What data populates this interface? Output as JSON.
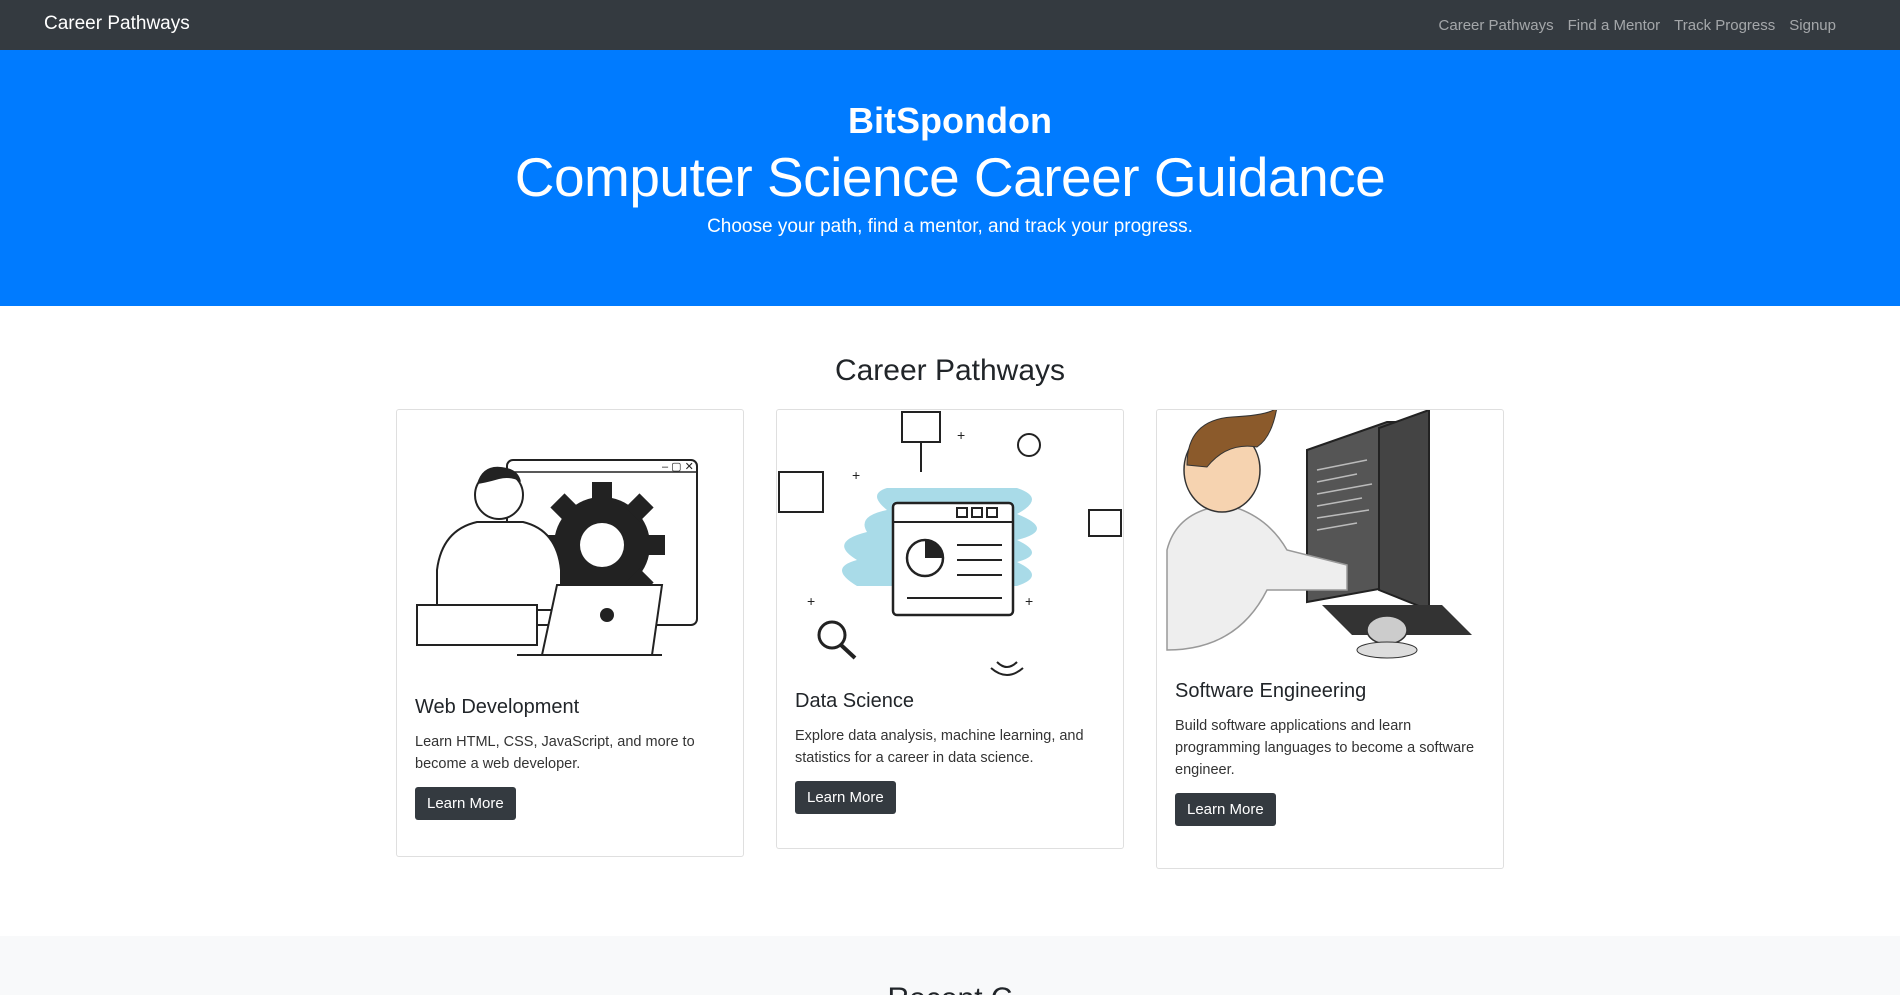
{
  "nav": {
    "brand": "Career Pathways",
    "links": [
      "Career Pathways",
      "Find a Mentor",
      "Track Progress",
      "Signup"
    ]
  },
  "hero": {
    "brand": "BitSpondon",
    "title": "Computer Science Career Guidance",
    "subtitle": "Choose your path, find a mentor, and track your progress."
  },
  "pathways": {
    "title": "Career Pathways",
    "cards": [
      {
        "title": "Web Development",
        "text": "Learn HTML, CSS, JavaScript, and more to become a web developer.",
        "button": "Learn More",
        "image_icon": "developer-laptop-gear-illustration"
      },
      {
        "title": "Data Science",
        "text": "Explore data analysis, machine learning, and statistics for a career in data science.",
        "button": "Learn More",
        "image_icon": "data-dashboard-illustration"
      },
      {
        "title": "Software Engineering",
        "text": "Build software applications and learn programming languages to become a software engineer.",
        "button": "Learn More",
        "image_icon": "programmer-monitors-illustration"
      }
    ]
  },
  "next_section": {
    "title": "Recent C"
  },
  "colors": {
    "navbar": "#343a40",
    "hero": "#007bff",
    "button": "#343a40"
  }
}
